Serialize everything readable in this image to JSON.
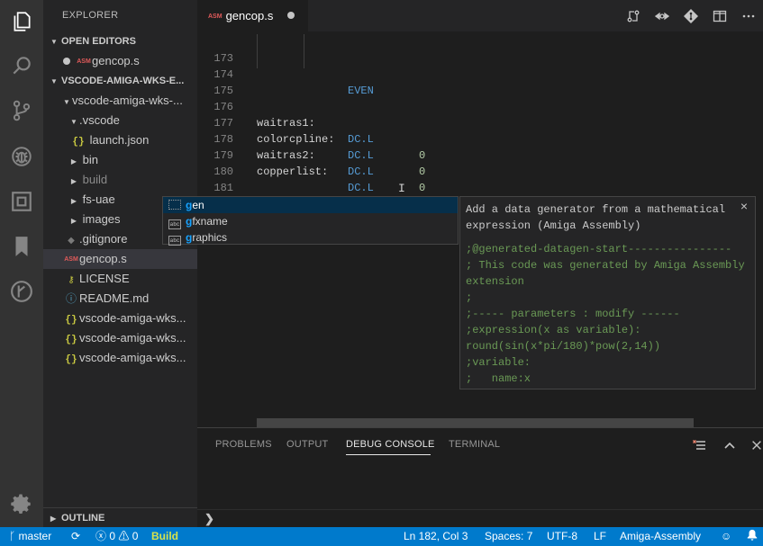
{
  "sidebar": {
    "title": "EXPLORER",
    "open_editors": {
      "label": "OPEN EDITORS",
      "items": [
        {
          "name": "gencop.s"
        }
      ]
    },
    "workspace": {
      "label": "VSCODE-AMIGA-WKS-E...",
      "root": "vscode-amiga-wks-...",
      "items": [
        {
          "name": ".vscode"
        },
        {
          "name": "launch.json"
        },
        {
          "name": "bin"
        },
        {
          "name": "build"
        },
        {
          "name": "fs-uae"
        },
        {
          "name": "images"
        },
        {
          "name": ".gitignore"
        },
        {
          "name": "gencop.s"
        },
        {
          "name": "LICENSE"
        },
        {
          "name": "README.md"
        },
        {
          "name": "vscode-amiga-wks..."
        },
        {
          "name": "vscode-amiga-wks..."
        },
        {
          "name": "vscode-amiga-wks..."
        }
      ]
    },
    "outline": "OUTLINE"
  },
  "tab": {
    "label": "gencop.s",
    "icon_text": "ASM"
  },
  "editor": {
    "lines": [
      {
        "n": "173"
      },
      {
        "n": "174",
        "op": "EVEN"
      },
      {
        "n": "175"
      },
      {
        "n": "176",
        "label": "waitras1:",
        "op": "DC.L",
        "val": "0"
      },
      {
        "n": "177",
        "label": "colorcpline:",
        "op": "DC.L",
        "val": "0"
      },
      {
        "n": "178",
        "label": "waitras2:",
        "op": "DC.L",
        "val": "0"
      },
      {
        "n": "179",
        "label": "copperlist:",
        "op": "DC.L",
        "val": "0"
      },
      {
        "n": "180"
      },
      {
        "n": "181"
      },
      {
        "n": "182",
        "typed": "ge"
      }
    ]
  },
  "suggest": {
    "items": [
      {
        "match": "g",
        "first": "en",
        "full": "gen",
        "kind": "snippet"
      },
      {
        "match": "g",
        "rest": "fxname",
        "kind": "abc"
      },
      {
        "match": "g",
        "rest": "raphics",
        "kind": "abc"
      }
    ],
    "abc_icon": "abc"
  },
  "details": {
    "title": "Add a data generator from a mathematical expression (Amiga Assembly)",
    "body": ";@generated-datagen-start----------------\n; This code was generated by Amiga Assembly extension\n;\n;----- parameters : modify ------\n;expression(x as variable):\nround(sin(x*pi/180)*pow(2,14))\n;variable:\n;   name:x",
    "close": "×"
  },
  "panel": {
    "tabs": [
      "PROBLEMS",
      "OUTPUT",
      "DEBUG CONSOLE",
      "TERMINAL"
    ],
    "active": "DEBUG CONSOLE",
    "prompt": "❯"
  },
  "status": {
    "branch": "master",
    "errors": "0",
    "warnings": "0",
    "build": "Build",
    "position": "Ln 182, Col 3",
    "spaces": "Spaces: 7",
    "encoding": "UTF-8",
    "eol": "LF",
    "language": "Amiga-Assembly"
  },
  "colors": {
    "accent": "#007acc",
    "keyword": "#569cd6",
    "number": "#b5cea8",
    "comment": "#6a9955",
    "match": "#18a3ff",
    "build": "#d7e24d"
  },
  "icons": {
    "activity": [
      "files-icon",
      "search-icon",
      "source-control-icon",
      "debug-icon",
      "extensions-icon",
      "bookmark-icon",
      "git-history-icon",
      "settings-gear-icon"
    ],
    "editor_actions": [
      "open-changes-icon",
      "toggle-preview-icon",
      "git-compare-icon",
      "split-editor-icon",
      "more-actions-icon"
    ]
  }
}
